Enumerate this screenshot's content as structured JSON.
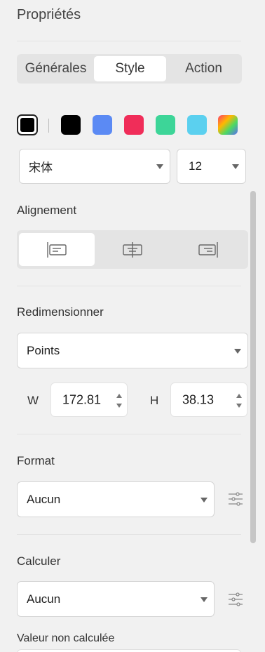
{
  "panel": {
    "title": "Propriétés"
  },
  "tabs": [
    {
      "label": "Générales",
      "active": false
    },
    {
      "label": "Style",
      "active": true
    },
    {
      "label": "Action",
      "active": false
    }
  ],
  "colors": {
    "selected": "#000000",
    "swatches": [
      "#000000",
      "#5b8af4",
      "#f02d59",
      "#3dd598",
      "#5bd0ef",
      "gradient"
    ]
  },
  "font": {
    "family": "宋体",
    "size": "12"
  },
  "alignment": {
    "label": "Alignement",
    "options": [
      "align-left",
      "align-center",
      "align-right"
    ],
    "selected": "align-left"
  },
  "resize": {
    "label": "Redimensionner",
    "unit": "Points",
    "w_label": "W",
    "w_value": "172.81",
    "h_label": "H",
    "h_value": "38.13"
  },
  "format": {
    "label": "Format",
    "value": "Aucun"
  },
  "calculate": {
    "label": "Calculer",
    "value": "Aucun"
  },
  "uncalculated": {
    "label": "Valeur non calculée"
  }
}
